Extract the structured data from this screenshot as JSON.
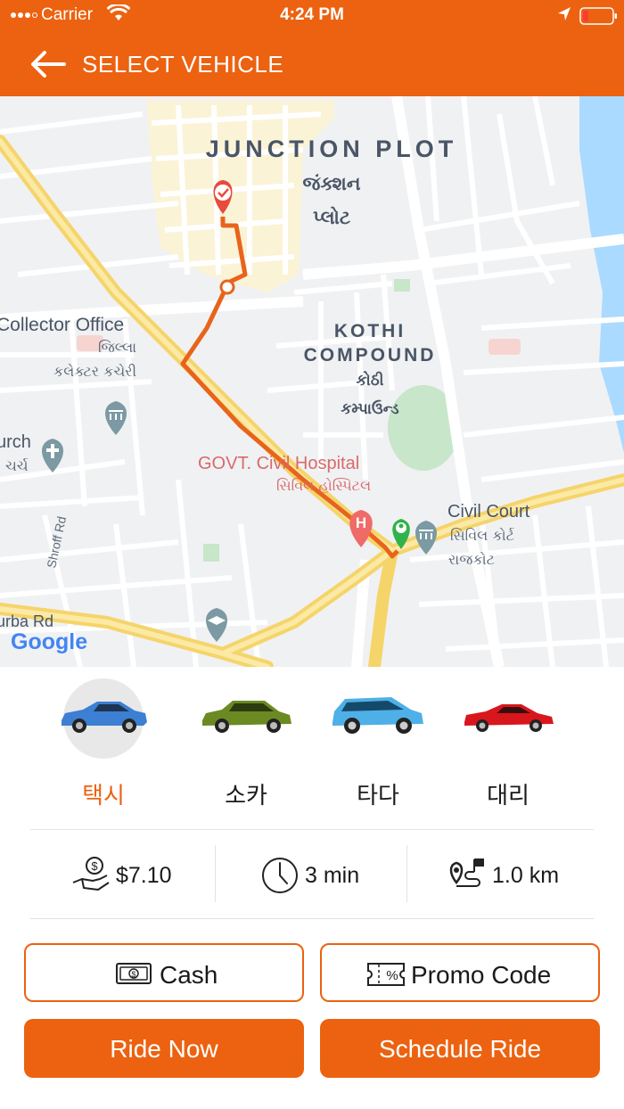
{
  "status_bar": {
    "carrier": "Carrier",
    "time": "4:24 PM"
  },
  "header": {
    "title": "SELECT VEHICLE",
    "back_icon": "arrow-left-icon",
    "background_color": "#ec6210"
  },
  "map": {
    "labels": {
      "junction_plot_en": "JUNCTION PLOT",
      "junction_plot_gu_1": "જંક્શન",
      "junction_plot_gu_2": "પ્લોટ",
      "collector_office_en": "Collector Office",
      "collector_office_gu_1": "જિલ્લા",
      "collector_office_gu_2": "કલેક્ટર કચેરી",
      "kothi_en_1": "KOTHI",
      "kothi_en_2": "COMPOUND",
      "kothi_gu_1": "કોઠી",
      "kothi_gu_2": "કમ્પાઉન્ડ",
      "church_en": "urch",
      "church_gu": "ચર્ચ",
      "hospital_en": "GOVT. Civil Hospital",
      "hospital_gu": "સિવિલ હોસ્પિટલ",
      "civil_court_en": "Civil Court",
      "civil_court_gu_1": "સિવિલ કોર્ટ",
      "civil_court_gu_2": "રાજકોટ",
      "shroff_rd": "Shroff Rd",
      "kasturba_rd": "urba Rd",
      "google": "Google"
    }
  },
  "vehicles": [
    {
      "label": "택시",
      "icon": "car-blue-sedan-icon",
      "selected": true
    },
    {
      "label": "소카",
      "icon": "car-green-hatchback-icon",
      "selected": false
    },
    {
      "label": "타다",
      "icon": "car-lightblue-hatchback-icon",
      "selected": false
    },
    {
      "label": "대리",
      "icon": "car-red-coupe-icon",
      "selected": false
    }
  ],
  "trip_info": {
    "fare": "$7.10",
    "duration": "3 min",
    "distance": "1.0 km"
  },
  "payment": {
    "cash_label": "Cash",
    "promo_label": "Promo Code"
  },
  "actions": {
    "ride_now": "Ride Now",
    "schedule_ride": "Schedule Ride"
  },
  "colors": {
    "accent": "#ec6210",
    "route": "#e8641b",
    "pickup_pin": "#e84a3c",
    "dropoff_pin": "#2fb34a"
  }
}
